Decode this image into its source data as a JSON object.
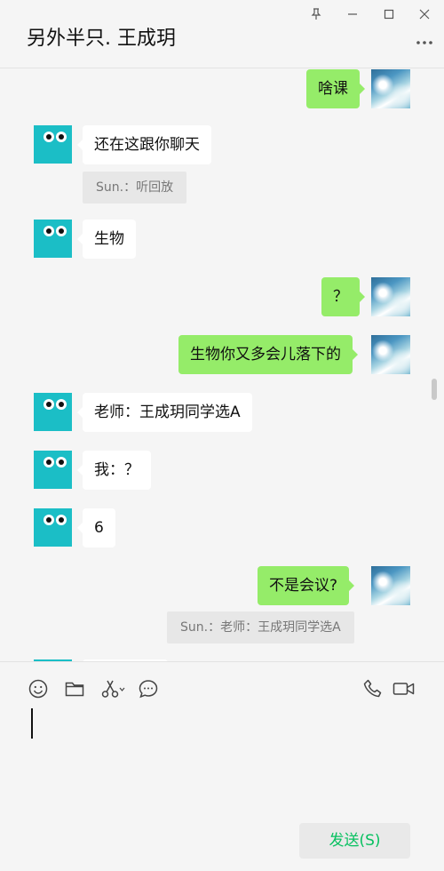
{
  "window": {
    "title": "另外半只. 王成玥",
    "controls": [
      "pin-icon",
      "minimize-icon",
      "maximize-icon",
      "close-icon"
    ],
    "more_icon": "more-icon"
  },
  "messages": [
    {
      "side": "right",
      "text": "啥课"
    },
    {
      "side": "left",
      "text": "还在这跟你聊天",
      "quote": "Sun.：听回放"
    },
    {
      "side": "left",
      "text": "生物"
    },
    {
      "side": "right",
      "text": "？"
    },
    {
      "side": "right",
      "text": "生物你又多会儿落下的"
    },
    {
      "side": "left",
      "text": "老师：王成玥同学选A"
    },
    {
      "side": "left",
      "text": "我：？"
    },
    {
      "side": "left",
      "text": "6"
    },
    {
      "side": "right",
      "text": "不是会议?",
      "quote": "Sun.：老师：王成玥同学选A"
    }
  ],
  "toolbar": {
    "icons": [
      "emoji-icon",
      "folder-icon",
      "scissors-icon",
      "chat-history-icon",
      "phone-icon",
      "video-call-icon"
    ]
  },
  "input": {
    "value": ""
  },
  "send_button": {
    "label": "发送(S)"
  },
  "colors": {
    "background": "#f5f5f5",
    "own_bubble": "#95ec69",
    "other_bubble": "#ffffff",
    "send_text": "#07c160",
    "avatar_teal": "#1bbec6"
  }
}
